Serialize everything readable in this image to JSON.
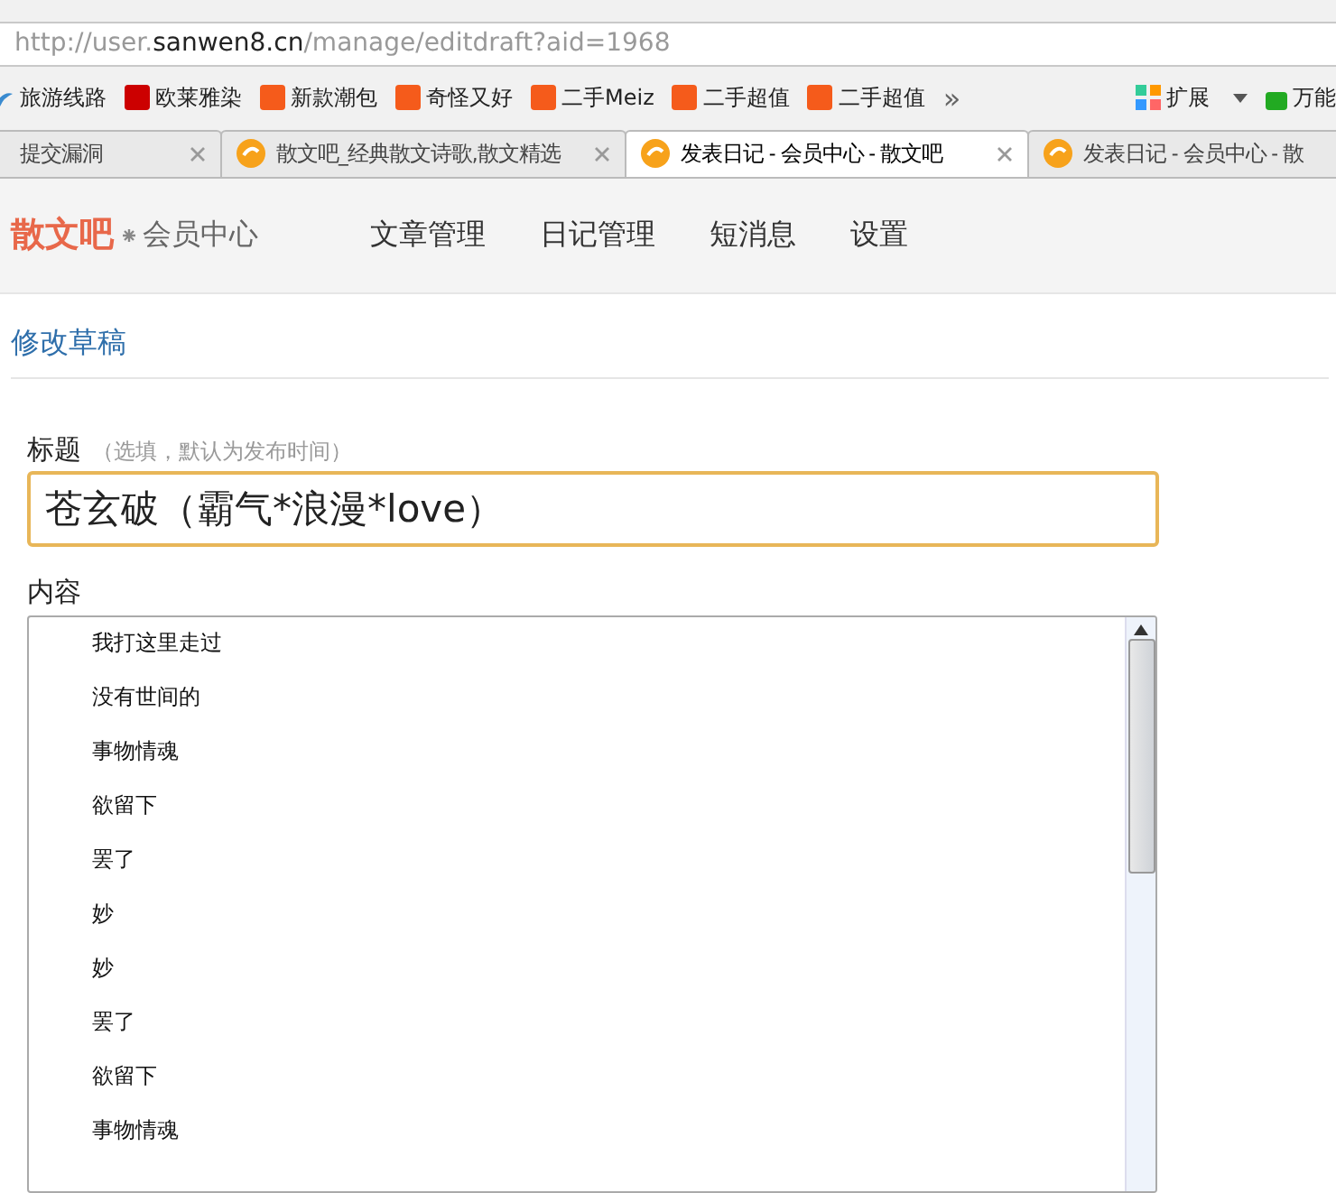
{
  "address_bar": {
    "url_parts": [
      {
        "text": "http://user.",
        "kind": "muted"
      },
      {
        "text": "sanwen8.cn",
        "kind": "host"
      },
      {
        "text": "/manage/editdraft?aid=1968",
        "kind": "muted"
      }
    ]
  },
  "bookmarks": [
    {
      "label": "旅游线路",
      "kind": "plain"
    },
    {
      "label": "欧莱雅染",
      "kind": "t"
    },
    {
      "label": "新款潮包",
      "kind": "tao"
    },
    {
      "label": "奇怪又好",
      "kind": "tao"
    },
    {
      "label": "二手Meiz",
      "kind": "tao"
    },
    {
      "label": "二手超值",
      "kind": "tao"
    },
    {
      "label": "二手超值",
      "kind": "tao"
    }
  ],
  "bookmark_more": "»",
  "extensions": [
    {
      "label": "扩展",
      "kind": "grid"
    },
    {
      "label": "万能",
      "kind": "green"
    }
  ],
  "tabs": [
    {
      "title": "提交漏洞",
      "selected": false,
      "icon": false,
      "close_button": true
    },
    {
      "title": "散文吧_经典散文诗歌,散文精选",
      "selected": false,
      "icon": true,
      "close_button": true
    },
    {
      "title": "发表日记 - 会员中心 - 散文吧",
      "selected": true,
      "icon": true,
      "close_button": true
    },
    {
      "title": "发表日记 - 会员中心 - 散",
      "selected": false,
      "icon": true,
      "close_button": false
    }
  ],
  "site": {
    "logo": "散文吧",
    "subtitle": "会员中心",
    "nav": [
      "文章管理",
      "日记管理",
      "短消息",
      "设置"
    ]
  },
  "page_title": "修改草稿",
  "title_field": {
    "label": "标题",
    "hint": "（选填，默认为发布时间）",
    "value": "苍玄破（霸气*浪漫*love）"
  },
  "content_field": {
    "label": "内容",
    "lines": [
      "我打这里走过",
      "没有世间的",
      "事物情魂",
      "欲留下",
      "罢了",
      "妙",
      "妙",
      "罢了",
      "欲留下",
      "事物情魂"
    ]
  }
}
